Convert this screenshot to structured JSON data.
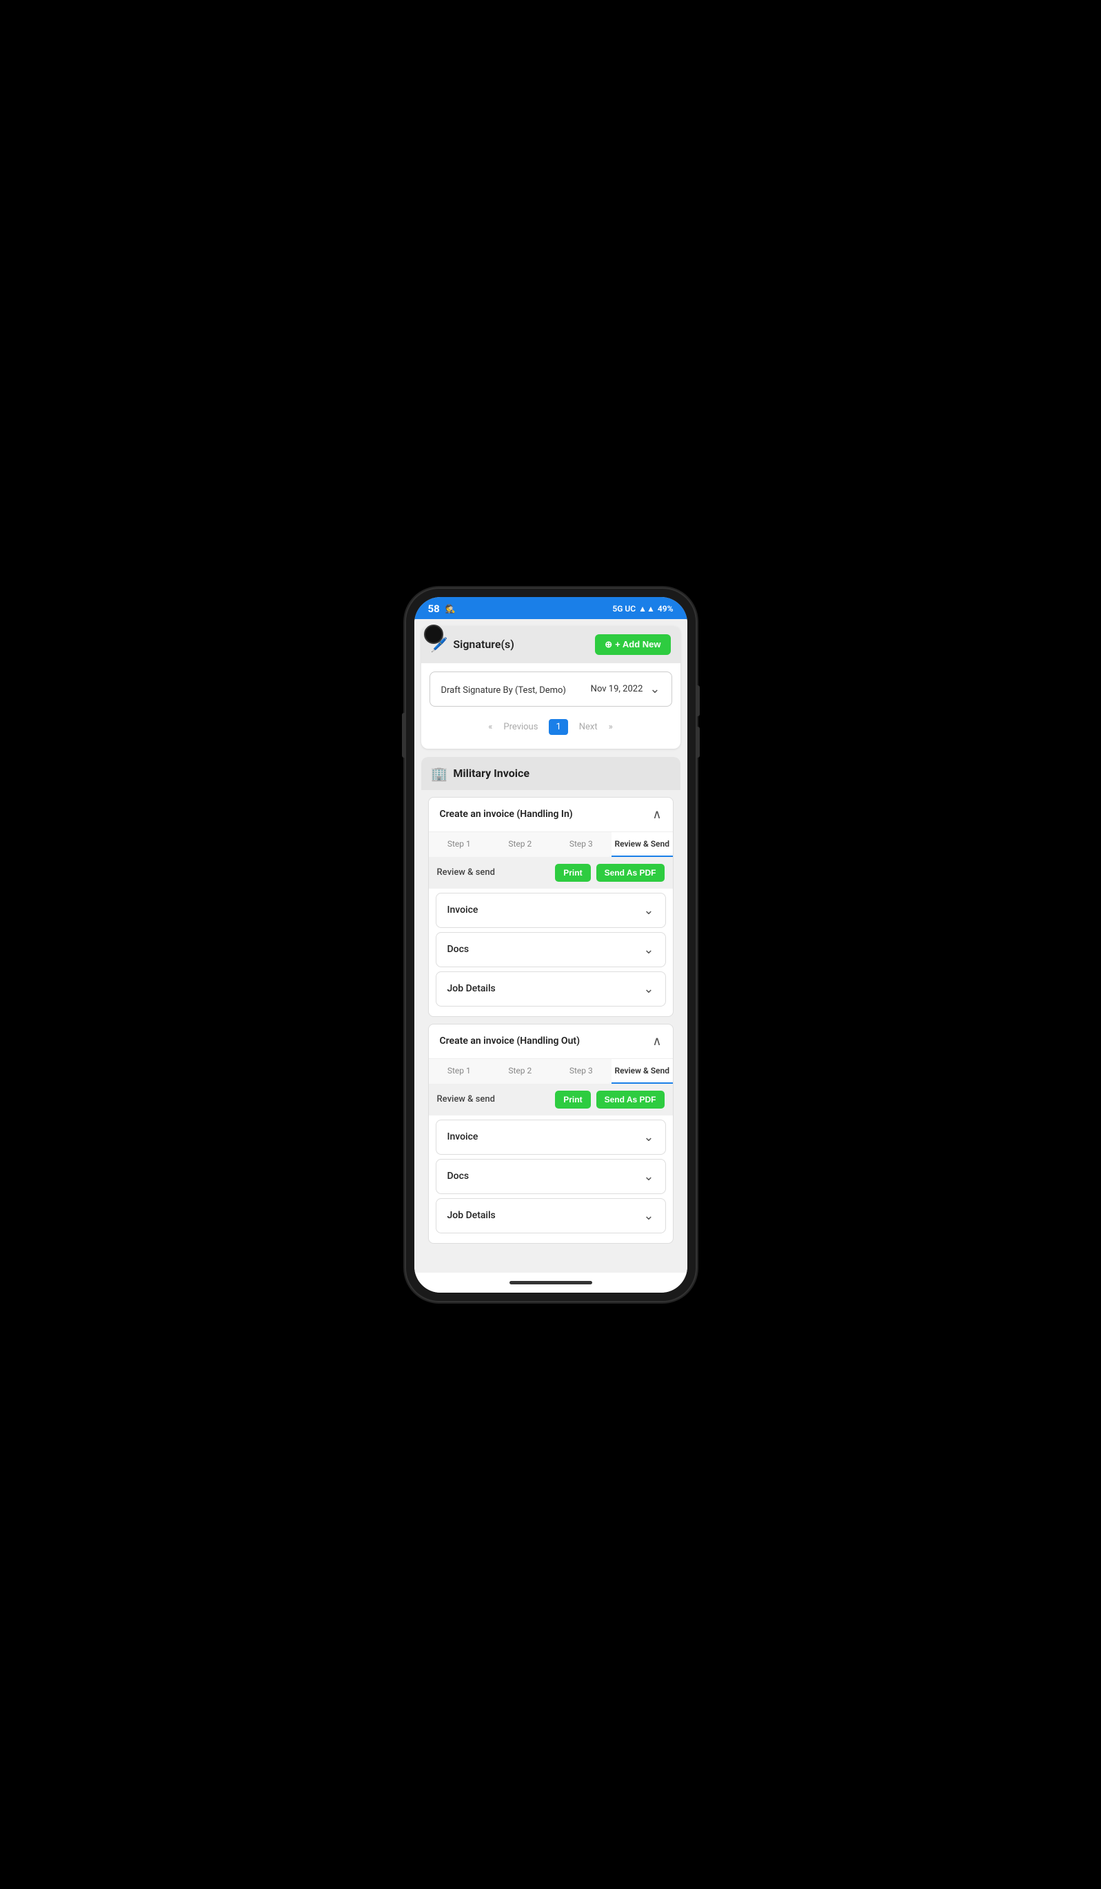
{
  "statusBar": {
    "time": "58",
    "network": "5G UC",
    "battery": "49%",
    "signal_icon": "signal-bars"
  },
  "signatures": {
    "section_title": "Signature(s)",
    "add_new_label": "+ Add New",
    "items": [
      {
        "label": "Draft Signature By  (Test, Demo)",
        "date": "Nov 19, 2022"
      }
    ],
    "pagination": {
      "previous_label": "Previous",
      "next_label": "Next",
      "current_page": 1,
      "pages": [
        1
      ]
    }
  },
  "militaryInvoice": {
    "section_title": "Military Invoice",
    "invoices": [
      {
        "header_title": "Create an invoice (Handling In)",
        "steps": [
          "Step 1",
          "Step 2",
          "Step 3",
          "Review & Send"
        ],
        "active_step": 3,
        "review_label": "Review & send",
        "print_label": "Print",
        "send_pdf_label": "Send As PDF",
        "expandable_rows": [
          {
            "label": "Invoice"
          },
          {
            "label": "Docs"
          },
          {
            "label": "Job Details"
          }
        ]
      },
      {
        "header_title": "Create an invoice (Handling Out)",
        "steps": [
          "Step 1",
          "Step 2",
          "Step 3",
          "Review & Send"
        ],
        "active_step": 3,
        "review_label": "Review & send",
        "print_label": "Print",
        "send_pdf_label": "Send As PDF",
        "expandable_rows": [
          {
            "label": "Invoice"
          },
          {
            "label": "Docs"
          },
          {
            "label": "Job Details"
          }
        ]
      }
    ]
  },
  "colors": {
    "status_bar_bg": "#1a7fe8",
    "add_new_green": "#2ecc40",
    "active_tab_blue": "#1a7fe8",
    "active_page_blue": "#1a7fe8"
  }
}
